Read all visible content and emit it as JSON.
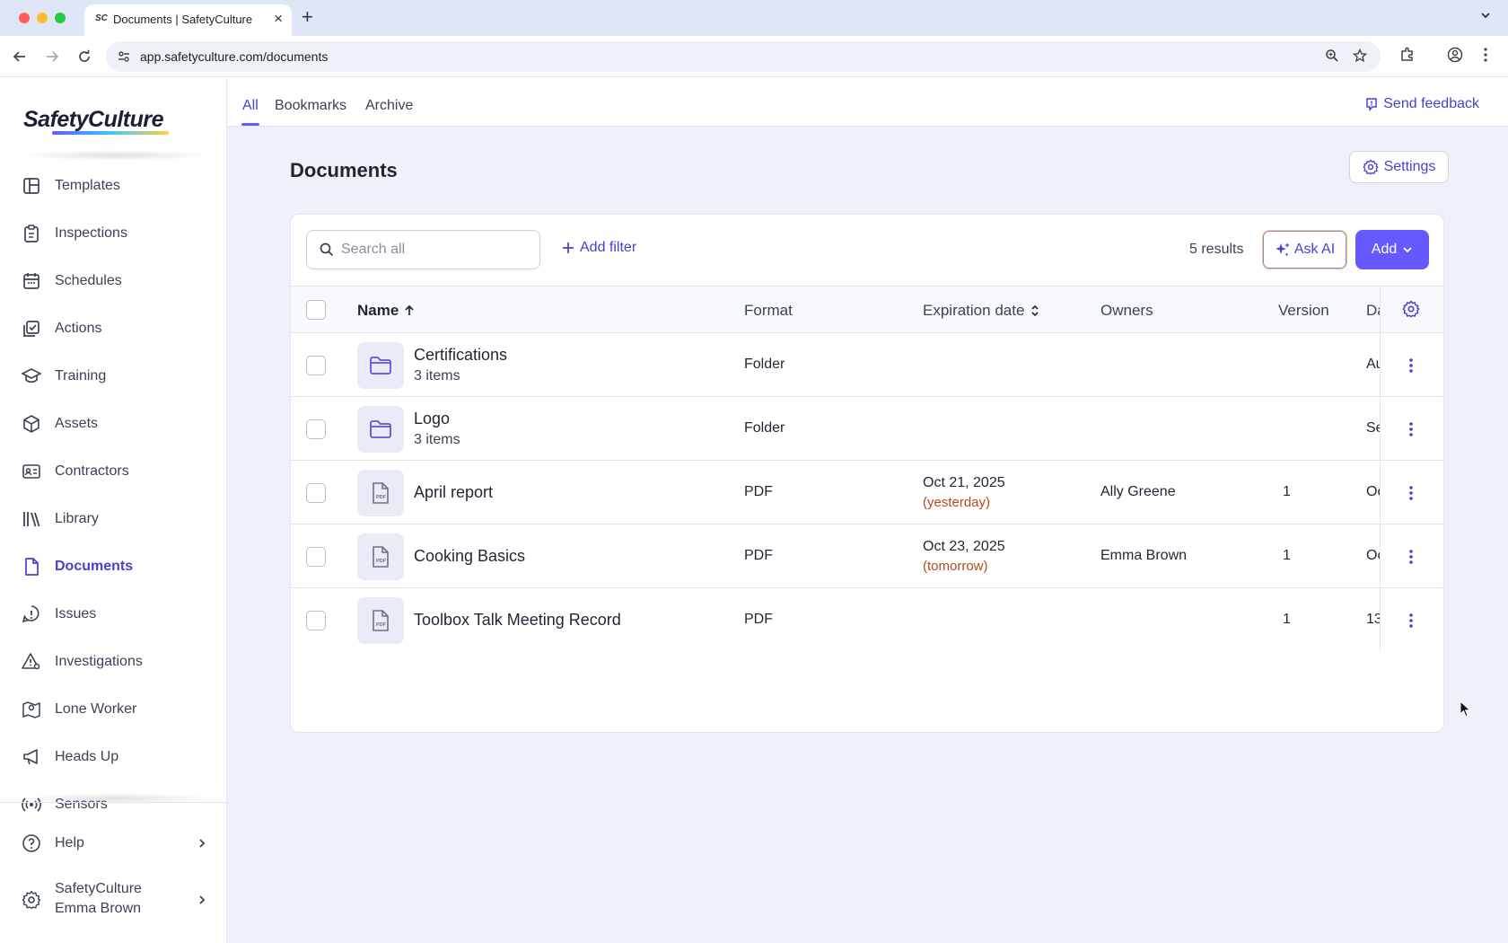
{
  "browser": {
    "tab_title": "Documents | SafetyCulture",
    "tab_favicon": "SC",
    "url": "app.safetyculture.com/documents"
  },
  "sidebar": {
    "logo": "SafetyCulture",
    "items": [
      {
        "label": "Templates",
        "icon": "templates-icon"
      },
      {
        "label": "Inspections",
        "icon": "clipboard-icon"
      },
      {
        "label": "Schedules",
        "icon": "calendar-icon"
      },
      {
        "label": "Actions",
        "icon": "checklist-icon"
      },
      {
        "label": "Training",
        "icon": "graduation-cap-icon"
      },
      {
        "label": "Assets",
        "icon": "cube-icon"
      },
      {
        "label": "Contractors",
        "icon": "id-card-icon"
      },
      {
        "label": "Library",
        "icon": "books-icon"
      },
      {
        "label": "Documents",
        "icon": "document-icon",
        "active": true
      },
      {
        "label": "Issues",
        "icon": "alert-icon"
      },
      {
        "label": "Investigations",
        "icon": "warning-search-icon"
      },
      {
        "label": "Lone Worker",
        "icon": "map-pin-icon"
      },
      {
        "label": "Heads Up",
        "icon": "megaphone-icon"
      },
      {
        "label": "Sensors",
        "icon": "broadcast-icon"
      }
    ],
    "help_label": "Help",
    "org_name": "SafetyCulture",
    "user_name": "Emma Brown"
  },
  "topnav": {
    "tabs": [
      "All",
      "Bookmarks",
      "Archive"
    ],
    "active_tab": "All",
    "feedback_label": "Send feedback"
  },
  "page": {
    "title": "Documents",
    "settings_label": "Settings"
  },
  "toolbar": {
    "search_placeholder": "Search all",
    "add_filter_label": "Add filter",
    "results_text": "5 results",
    "ask_ai_label": "Ask AI",
    "add_label": "Add"
  },
  "table": {
    "headers": {
      "name": "Name",
      "format": "Format",
      "expiration": "Expiration date",
      "owners": "Owners",
      "version": "Version",
      "date": "Da"
    },
    "rows": [
      {
        "name": "Certifications",
        "sub": "3 items",
        "type": "folder",
        "format": "Folder",
        "exp_date": "",
        "exp_rel": "",
        "owner": "",
        "version": "",
        "date": "Au"
      },
      {
        "name": "Logo",
        "sub": "3 items",
        "type": "folder",
        "format": "Folder",
        "exp_date": "",
        "exp_rel": "",
        "owner": "",
        "version": "",
        "date": "Se"
      },
      {
        "name": "April report",
        "sub": "",
        "type": "pdf",
        "format": "PDF",
        "exp_date": "Oct 21, 2025",
        "exp_rel": "(yesterday)",
        "owner": "Ally Greene",
        "version": "1",
        "date": "Oc"
      },
      {
        "name": "Cooking Basics",
        "sub": "",
        "type": "pdf",
        "format": "PDF",
        "exp_date": "Oct 23, 2025",
        "exp_rel": "(tomorrow)",
        "owner": "Emma Brown",
        "version": "1",
        "date": "Oc"
      },
      {
        "name": "Toolbox Talk Meeting Record",
        "sub": "",
        "type": "pdf",
        "format": "PDF",
        "exp_date": "",
        "exp_rel": "",
        "owner": "",
        "version": "1",
        "date": "13"
      }
    ]
  },
  "colors": {
    "accent": "#6559ff",
    "accent_text": "#4740d4",
    "warning_text": "#b44a1e",
    "page_bg": "#eef1fa"
  }
}
